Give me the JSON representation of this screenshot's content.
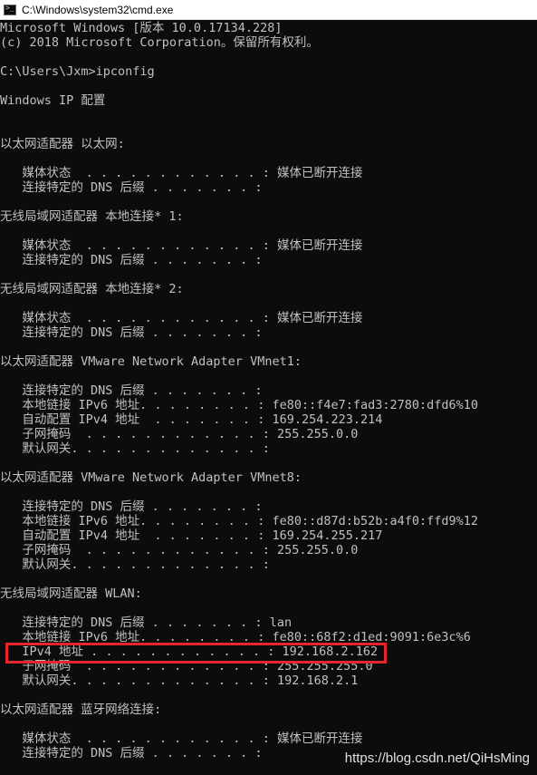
{
  "window": {
    "title": "C:\\Windows\\system32\\cmd.exe",
    "icon": "cmd-icon",
    "icon_glyph": ">_"
  },
  "console": {
    "text_color": "#c0c0c0",
    "background": "#0c0c0c",
    "lines": [
      "Microsoft Windows [版本 10.0.17134.228]",
      "(c) 2018 Microsoft Corporation。保留所有权利。",
      "",
      "C:\\Users\\Jxm>ipconfig",
      "",
      "Windows IP 配置",
      "",
      "",
      "以太网适配器 以太网:",
      "",
      "   媒体状态  . . . . . . . . . . . . : 媒体已断开连接",
      "   连接特定的 DNS 后缀 . . . . . . . :",
      "",
      "无线局域网适配器 本地连接* 1:",
      "",
      "   媒体状态  . . . . . . . . . . . . : 媒体已断开连接",
      "   连接特定的 DNS 后缀 . . . . . . . :",
      "",
      "无线局域网适配器 本地连接* 2:",
      "",
      "   媒体状态  . . . . . . . . . . . . : 媒体已断开连接",
      "   连接特定的 DNS 后缀 . . . . . . . :",
      "",
      "以太网适配器 VMware Network Adapter VMnet1:",
      "",
      "   连接特定的 DNS 后缀 . . . . . . . :",
      "   本地链接 IPv6 地址. . . . . . . . : fe80::f4e7:fad3:2780:dfd6%10",
      "   自动配置 IPv4 地址  . . . . . . . : 169.254.223.214",
      "   子网掩码  . . . . . . . . . . . . : 255.255.0.0",
      "   默认网关. . . . . . . . . . . . . :",
      "",
      "以太网适配器 VMware Network Adapter VMnet8:",
      "",
      "   连接特定的 DNS 后缀 . . . . . . . :",
      "   本地链接 IPv6 地址. . . . . . . . : fe80::d87d:b52b:a4f0:ffd9%12",
      "   自动配置 IPv4 地址  . . . . . . . : 169.254.255.217",
      "   子网掩码  . . . . . . . . . . . . : 255.255.0.0",
      "   默认网关. . . . . . . . . . . . . :",
      "",
      "无线局域网适配器 WLAN:",
      "",
      "   连接特定的 DNS 后缀 . . . . . . . : lan",
      "   本地链接 IPv6 地址. . . . . . . . : fe80::68f2:d1ed:9091:6e3c%6",
      "   IPv4 地址 . . . . . . . . . . . . : 192.168.2.162",
      "   子网掩码  . . . . . . . . . . . . : 255.255.255.0",
      "   默认网关. . . . . . . . . . . . . : 192.168.2.1",
      "",
      "以太网适配器 蓝牙网络连接:",
      "",
      "   媒体状态  . . . . . . . . . . . . : 媒体已断开连接",
      "   连接特定的 DNS 后缀 . . . . . . . :"
    ]
  },
  "annotation": {
    "highlight_color": "#e8242c",
    "highlighted_line": "   IPv4 地址 . . . . . . . . . . . . : 192.168.2.162"
  },
  "watermark": "https://blog.csdn.net/QiHsMing"
}
